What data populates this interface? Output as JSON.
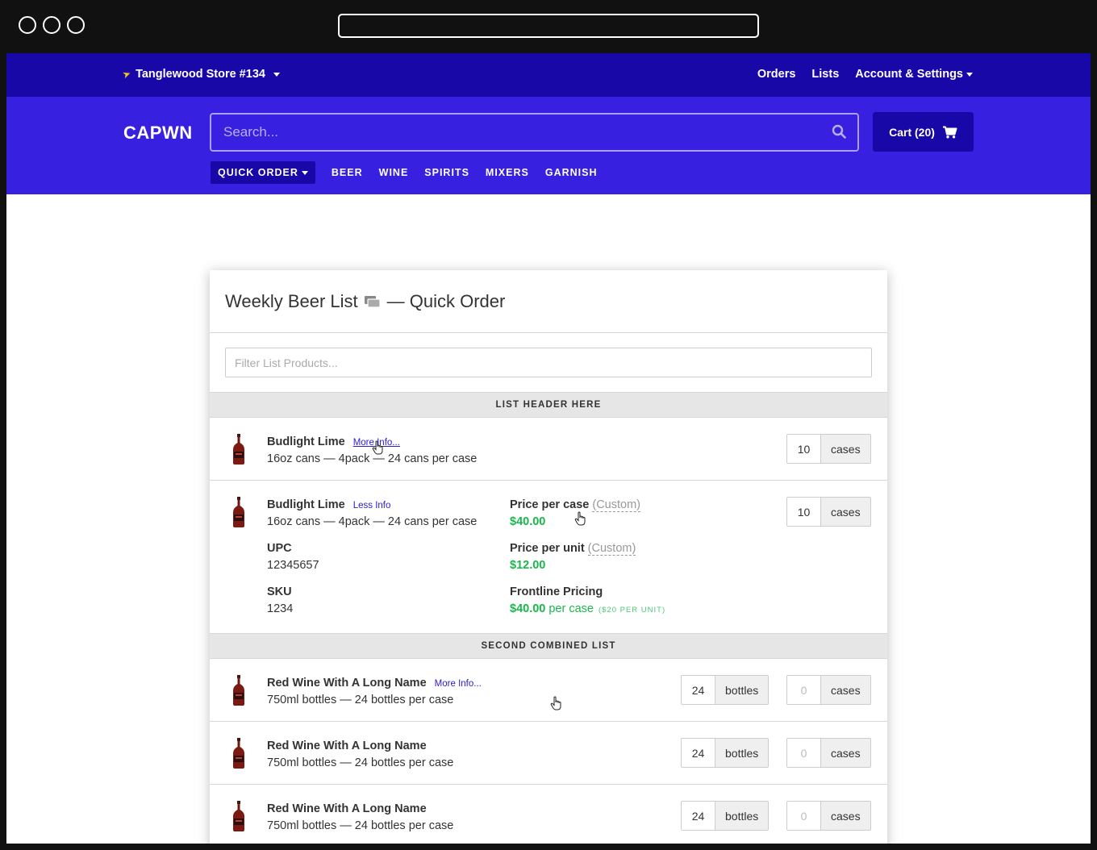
{
  "topnav": {
    "store": "Tanglewood Store #134",
    "links": {
      "orders": "Orders",
      "lists": "Lists",
      "account": "Account & Settings"
    }
  },
  "header": {
    "logo": "CAPWN",
    "search_placeholder": "Search...",
    "cart_label": "Cart (20)",
    "categories": {
      "quick_order": "QUICK ORDER",
      "beer": "BEER",
      "wine": "WINE",
      "spirits": "SPIRITS",
      "mixers": "MIXERS",
      "garnish": "GARNISH"
    }
  },
  "card": {
    "title": "Weekly Beer List",
    "subtitle": "— Quick Order",
    "filter_placeholder": "Filter List Products..."
  },
  "sections": [
    {
      "header": "LIST HEADER HERE",
      "items": [
        {
          "name": "Budlight Lime",
          "link": "More Info...",
          "desc": "16oz cans — 4pack — 24 cans per case",
          "qty": "10",
          "unit": "cases"
        },
        {
          "name": "Budlight Lime",
          "link": "Less Info",
          "desc": "16oz cans — 4pack — 24 cans per case",
          "qty": "10",
          "unit": "cases",
          "upc_label": "UPC",
          "upc": "12345657",
          "sku_label": "SKU",
          "sku": "1234",
          "price_case_label": "Price per case",
          "price_case_tag": "(Custom)",
          "price_case": "$40.00",
          "price_unit_label": "Price per unit",
          "price_unit_tag": "(Custom)",
          "price_unit": "$12.00",
          "frontline_label": "Frontline Pricing",
          "frontline_price": "$40.00",
          "frontline_per": "per case",
          "frontline_note": "($20 PER UNIT)"
        }
      ]
    },
    {
      "header": "SECOND COMBINED LIST",
      "items": [
        {
          "name": "Red Wine With A Long Name",
          "link": "More Info...",
          "desc": "750ml bottles — 24 bottles per case",
          "qty_bottles": "24",
          "unit_bottles": "bottles",
          "qty_cases": "0",
          "unit_cases": "cases"
        },
        {
          "name": "Red Wine With A Long Name",
          "desc": "750ml bottles — 24 bottles per case",
          "qty_bottles": "24",
          "unit_bottles": "bottles",
          "qty_cases": "0",
          "unit_cases": "cases"
        },
        {
          "name": "Red Wine With A Long Name",
          "desc": "750ml bottles — 24 bottles per case",
          "qty_bottles": "24",
          "unit_bottles": "bottles",
          "qty_cases": "0",
          "unit_cases": "cases"
        }
      ]
    }
  ],
  "colors": {
    "nav_dark": "#1808a8",
    "nav_primary": "#3820e0",
    "price_green": "#18b84c",
    "link": "#2a1ad0"
  }
}
